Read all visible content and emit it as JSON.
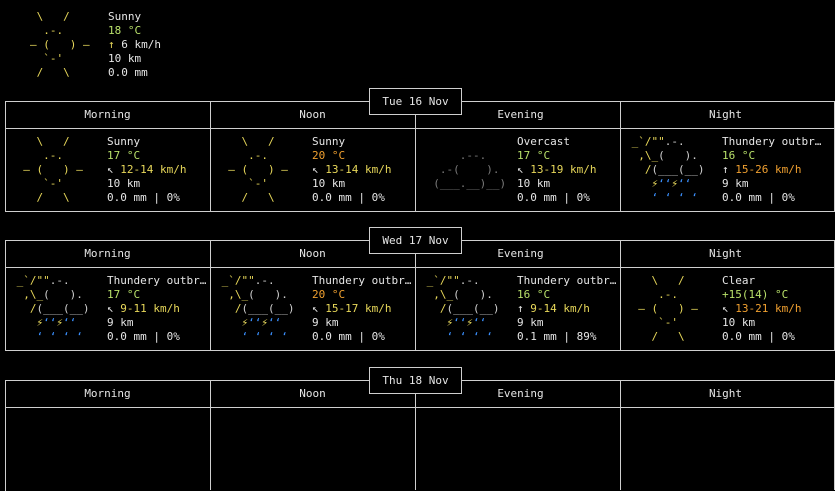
{
  "current": {
    "art": [
      " \\   /",
      "  .-.",
      "― (   ) ―",
      "  `-'",
      " /   \\"
    ],
    "condition": "Sunny",
    "temp": "18 °C",
    "wind_arrow": "↑",
    "wind": "6 km/h",
    "visibility": "10 km",
    "precip": "0.0 mm"
  },
  "segments": [
    "Morning",
    "Noon",
    "Evening",
    "Night"
  ],
  "days": [
    {
      "date": "Tue 16 Nov",
      "cells": [
        {
          "condition": "Sunny",
          "temp": "17 °C",
          "wind_arrow": "↖",
          "wind": "12-14 km/h",
          "visibility": "10 km",
          "precip": "0.0 mm | 0%"
        },
        {
          "condition": "Sunny",
          "temp": "20 °C",
          "wind_arrow": "↖",
          "wind": "13-14 km/h",
          "visibility": "10 km",
          "precip": "0.0 mm | 0%"
        },
        {
          "condition": "Overcast",
          "temp": "17 °C",
          "wind_arrow": "↖",
          "wind": "13-19 km/h",
          "visibility": "10 km",
          "precip": "0.0 mm | 0%"
        },
        {
          "condition": "Thundery outbr…",
          "temp": "16 °C",
          "wind_arrow": "↑",
          "wind": "15-26 km/h",
          "visibility": "9 km",
          "precip": "0.0 mm | 0%"
        }
      ]
    },
    {
      "date": "Wed 17 Nov",
      "cells": [
        {
          "condition": "Thundery outbr…",
          "temp": "17 °C",
          "wind_arrow": "↖",
          "wind": "9-11 km/h",
          "visibility": "9 km",
          "precip": "0.0 mm | 0%"
        },
        {
          "condition": "Thundery outbr…",
          "temp": "20 °C",
          "wind_arrow": "↖",
          "wind": "15-17 km/h",
          "visibility": "9 km",
          "precip": "0.0 mm | 0%"
        },
        {
          "condition": "Thundery outbr…",
          "temp": "16 °C",
          "wind_arrow": "↑",
          "wind": "9-14 km/h",
          "visibility": "9 km",
          "precip": "0.1 mm | 89%"
        },
        {
          "condition": "Clear",
          "temp": "+15(14) °C",
          "wind_arrow": "↖",
          "wind": "13-21 km/h",
          "visibility": "10 km",
          "precip": "0.0 mm | 0%"
        }
      ]
    },
    {
      "date": "Thu 18 Nov",
      "cells": []
    }
  ],
  "colors": {
    "sun": "#e8d85a",
    "temp_green": "#b8e06a",
    "temp_orange": "#f0a030",
    "cloud_dim": "#7a7a7a",
    "lightning": "#f0e060",
    "rain": "#3a90ff",
    "border": "#cfcfcf"
  },
  "icons": [
    "sun-icon",
    "cloud-icon",
    "thunder-icon",
    "clear-night-icon"
  ]
}
